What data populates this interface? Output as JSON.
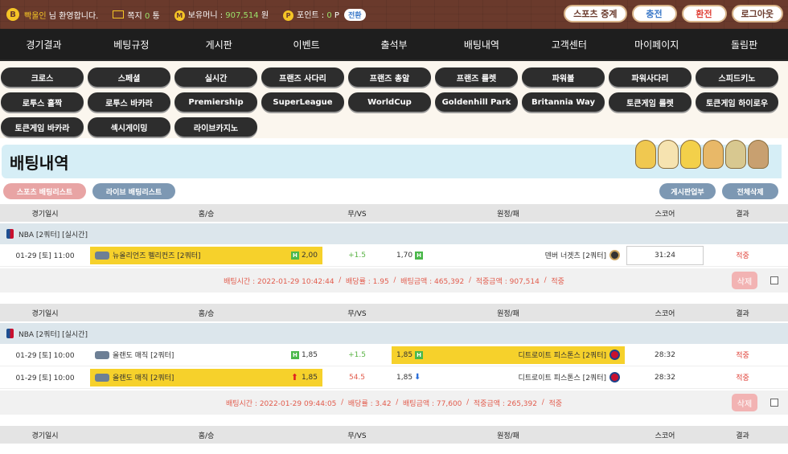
{
  "top": {
    "level_badge": "B",
    "username": "빡울인",
    "greeting": "님 환영합니다.",
    "note_label": "쪽지",
    "note_count": "0",
    "note_unit": "통",
    "money_label": "보유머니 :",
    "money_value": "907,514",
    "money_unit": "원",
    "point_label": "포인트 :",
    "point_value": "0",
    "point_unit": "P",
    "swap_label": "전환",
    "buttons": [
      "스포츠 중계",
      "충전",
      "환전",
      "로그아웃"
    ]
  },
  "nav": [
    "경기결과",
    "베팅규정",
    "게시판",
    "이벤트",
    "출석부",
    "배팅내역",
    "고객센터",
    "마이페이지",
    "돌림판"
  ],
  "games": [
    "크로스",
    "스페셜",
    "실시간",
    "프랜즈 사다리",
    "프랜즈 총알",
    "프랜즈 룰렛",
    "파워볼",
    "파워사다리",
    "스피드키노",
    "로투스 홀짝",
    "로투스 바카라",
    "Premiership",
    "SuperLeague",
    "WorldCup",
    "Goldenhill Park",
    "Britannia Way",
    "토큰게임 룰렛",
    "토큰게임 하이로우",
    "토큰게임 바카라",
    "섹시게이밍",
    "라이브카지노"
  ],
  "page_title": "배팅내역",
  "list_buttons": {
    "sports": "스포츠 배팅리스트",
    "live": "라이브 배팅리스트",
    "board": "게시판업부",
    "delete_all": "전체삭제"
  },
  "table_header": [
    "경기일시",
    "홈/승",
    "무/VS",
    "원정/패",
    "스코어",
    "결과"
  ],
  "bets": [
    {
      "league": "NBA [2쿼터] [실시간]",
      "rows": [
        {
          "date": "01-29 [토] 11:00",
          "home": "뉴올리언즈 펠리컨즈 [2쿼터]",
          "home_odds": "2,00",
          "home_badge": "H",
          "draw": "+1.5",
          "away": "덴버 너겟츠 [2쿼터]",
          "away_odds": "1,70",
          "away_badge": "H",
          "score": "31:24",
          "result": "적중"
        }
      ],
      "info": {
        "bet_time": "배팅시간 : 2022-01-29 10:42:44",
        "odds": "배당률 : 1.95",
        "amount": "배팅금액 : 465,392",
        "win_amount": "적중금액 : 907,514",
        "status": "적중",
        "delete": "삭제"
      }
    },
    {
      "league": "NBA [2쿼터] [실시간]",
      "rows": [
        {
          "date": "01-29 [토] 10:00",
          "home": "올랜도 매직 [2쿼터]",
          "home_odds": "1,85",
          "home_badge": "H",
          "draw": "+1.5",
          "away": "디트로이트 피스톤스 [2쿼터]",
          "away_odds": "1,85",
          "away_badge": "H",
          "score": "28:32",
          "result": "적중"
        },
        {
          "date": "01-29 [토] 10:00",
          "home": "올랜도 매직 [2쿼터]",
          "home_odds": "1,85",
          "home_badge": "",
          "draw": "54.5",
          "away": "디트로이트 피스톤스 [2쿼터]",
          "away_odds": "1,85",
          "away_badge": "",
          "score": "28:32",
          "result": "적중"
        }
      ],
      "info": {
        "bet_time": "배팅시간 : 2022-01-29 09:44:05",
        "odds": "배당률 : 3.42",
        "amount": "배팅금액 : 77,600",
        "win_amount": "적중금액 : 265,392",
        "status": "적중",
        "delete": "삭제"
      }
    }
  ],
  "colors": {
    "accent_yellow": "#f6d12b",
    "result_red": "#e0443b",
    "nav_bg": "#1e1e1e",
    "brown": "#6a3a2c"
  }
}
